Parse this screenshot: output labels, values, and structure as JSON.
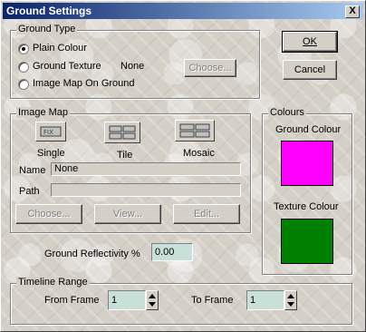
{
  "window": {
    "title": "Ground Settings",
    "close_label": "X"
  },
  "ground_type": {
    "title": "Ground Type",
    "options": [
      {
        "label": "Plain Colour",
        "selected": true
      },
      {
        "label": "Ground Texture",
        "selected": false
      },
      {
        "label": "Image Map On Ground",
        "selected": false
      }
    ],
    "texture_value": "None",
    "choose_label": "Choose..."
  },
  "image_map": {
    "title": "Image Map",
    "modes": [
      {
        "label": "Single",
        "icon": "single-image-icon"
      },
      {
        "label": "Tile",
        "icon": "tile-image-icon"
      },
      {
        "label": "Mosaic",
        "icon": "mosaic-image-icon"
      }
    ],
    "name_label": "Name",
    "name_value": "None",
    "path_label": "Path",
    "path_value": "",
    "choose_label": "Choose...",
    "view_label": "View...",
    "edit_label": "Edit..."
  },
  "reflectivity": {
    "label": "Ground Reflectivity %",
    "value": "0.00"
  },
  "timeline": {
    "title": "Timeline Range",
    "from_label": "From Frame",
    "from_value": "1",
    "to_label": "To Frame",
    "to_value": "1"
  },
  "colours": {
    "title": "Colours",
    "ground_label": "Ground Colour",
    "ground_color": "#ff00ff",
    "texture_label": "Texture Colour",
    "texture_color": "#008000"
  },
  "buttons": {
    "ok": "OK",
    "cancel": "Cancel"
  }
}
